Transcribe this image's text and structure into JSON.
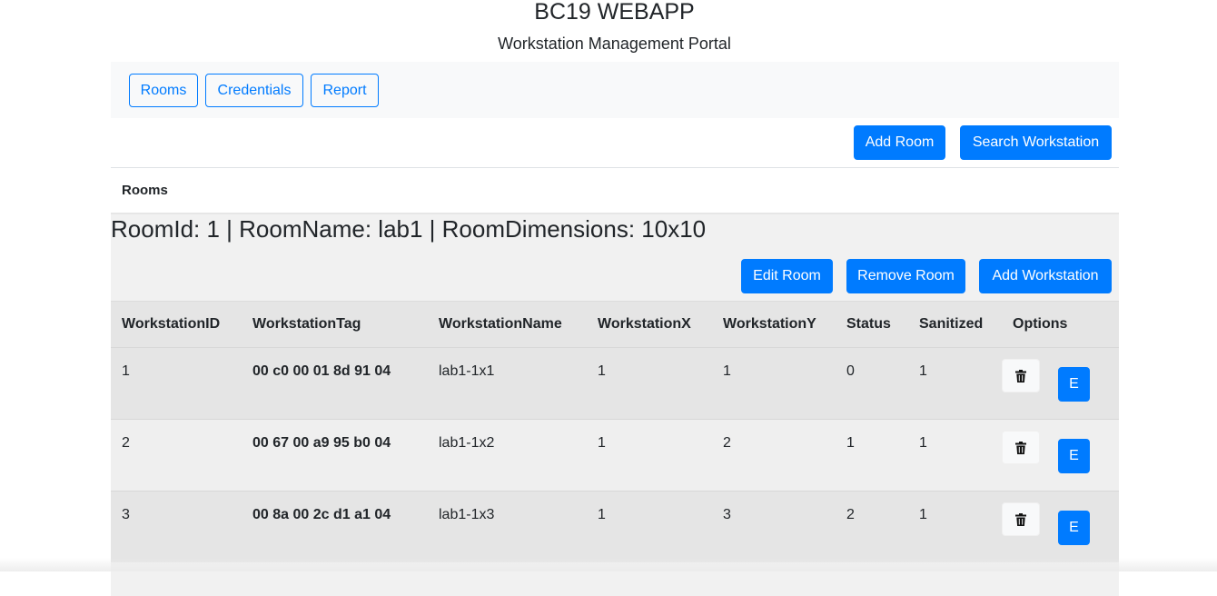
{
  "app": {
    "title": "BC19 WEBAPP",
    "subtitle": "Workstation Management Portal"
  },
  "nav": {
    "rooms": "Rooms",
    "credentials": "Credentials",
    "report": "Report"
  },
  "toolbar": {
    "add_room": "Add Room",
    "search_workstation": "Search Workstation"
  },
  "card": {
    "header": "Rooms"
  },
  "room": {
    "heading": "RoomId: 1 | RoomName: lab1 | RoomDimensions: 10x10",
    "edit_room": "Edit Room",
    "remove_room": "Remove Room",
    "add_workstation": "Add Workstation"
  },
  "table": {
    "columns": [
      "WorkstationID",
      "WorkstationTag",
      "WorkstationName",
      "WorkstationX",
      "WorkstationY",
      "Status",
      "Sanitized",
      "Options"
    ],
    "rows": [
      [
        "1",
        "00 c0 00 01 8d 91 04",
        "lab1-1x1",
        "1",
        "1",
        "0",
        "1"
      ],
      [
        "2",
        "00 67 00 a9 95 b0 04",
        "lab1-1x2",
        "1",
        "2",
        "1",
        "1"
      ],
      [
        "3",
        "00 8a 00 2c d1 a1 04",
        "lab1-1x3",
        "1",
        "3",
        "2",
        "1"
      ]
    ],
    "edit_label": "E",
    "delete_icon": "trash-icon"
  },
  "colors": {
    "primary": "#007bff",
    "navbar_bg": "#f8f9fa",
    "table_row_odd": "#e5e5e5",
    "table_row_even": "#efefef"
  }
}
